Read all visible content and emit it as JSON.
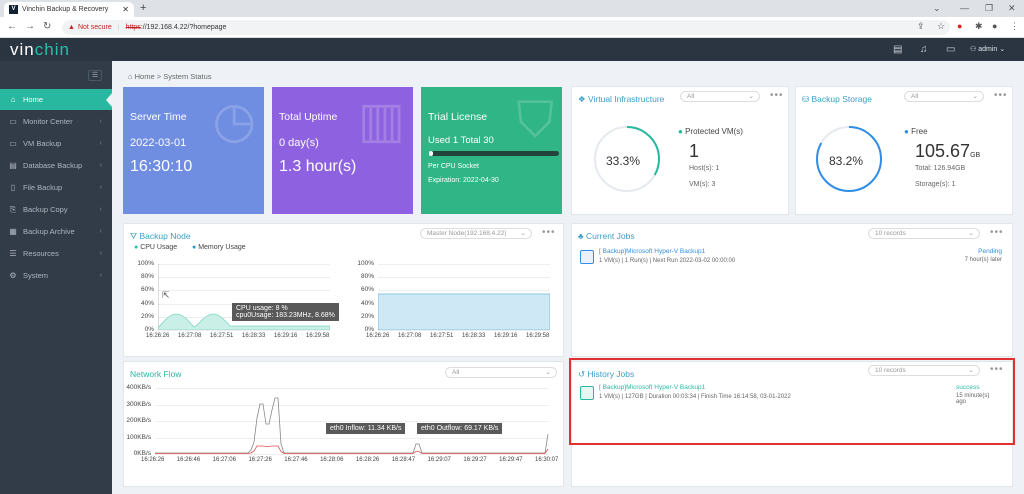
{
  "browser": {
    "tab_title": "Vinchin Backup & Recovery",
    "not_secure": "Not secure",
    "url_scheme": "https",
    "url_rest": "://192.168.4.22/?homepage"
  },
  "header": {
    "logo_a": "vin",
    "logo_b": "chin",
    "user": "admin"
  },
  "sidebar": {
    "items": [
      {
        "label": "Home",
        "icon": "home-icon"
      },
      {
        "label": "Monitor Center",
        "icon": "monitor-icon"
      },
      {
        "label": "VM Backup",
        "icon": "vm-icon"
      },
      {
        "label": "Database Backup",
        "icon": "database-icon"
      },
      {
        "label": "File Backup",
        "icon": "file-icon"
      },
      {
        "label": "Backup Copy",
        "icon": "copy-icon"
      },
      {
        "label": "Backup Archive",
        "icon": "archive-icon"
      },
      {
        "label": "Resources",
        "icon": "resources-icon"
      },
      {
        "label": "System",
        "icon": "system-icon"
      }
    ]
  },
  "breadcrumb": {
    "home": "Home",
    "current": "System Status"
  },
  "cards": {
    "server_time": {
      "title": "Server Time",
      "date": "2022-03-01",
      "time": "16:30:10",
      "color": "#6f8de1"
    },
    "uptime": {
      "title": "Total Uptime",
      "days": "0 day(s)",
      "hours": "1.3 hour(s)",
      "color": "#8e61e0"
    },
    "license": {
      "title": "Trial License",
      "used": "Used 1  Total 30",
      "used_fraction": 0.033,
      "per": "Per CPU Socket",
      "expiration": "Expiration: 2022-04-30",
      "color": "#2fb586"
    }
  },
  "virtual_infra": {
    "title": "Virtual Infrastructure",
    "filter": "All",
    "percent": "33.3%",
    "percent_value": 33.3,
    "label": "Protected VM(s)",
    "count": "1",
    "hosts": "Host(s): 1",
    "vms": "VM(s): 3"
  },
  "backup_storage": {
    "title": "Backup Storage",
    "filter": "All",
    "percent": "83.2%",
    "percent_value": 83.2,
    "label": "Free",
    "free": "105.67",
    "unit": "GB",
    "total": "Total: 126.94GB",
    "storages": "Storage(s): 1"
  },
  "backup_node": {
    "title": "Backup Node",
    "node": "Master Node(192.168.4.22)",
    "legend_cpu": "CPU Usage",
    "legend_mem": "Memory Usage",
    "yticks": [
      "100%",
      "80%",
      "60%",
      "40%",
      "20%",
      "0%"
    ],
    "xticks": [
      "16:26:26",
      "16:27:08",
      "16:27:51",
      "16:28:33",
      "16:29:16",
      "16:29:58"
    ],
    "tooltip_l1": "CPU usage: 8 %",
    "tooltip_l2": "cpu0Usage: 183.23MHz, 8.68%"
  },
  "network_flow": {
    "title": "Network Flow",
    "filter": "All",
    "yticks": [
      "400KB/s",
      "300KB/s",
      "200KB/s",
      "100KB/s",
      "0KB/s"
    ],
    "xticks": [
      "16:26:26",
      "16:26:46",
      "16:27:06",
      "16:27:26",
      "16:27:46",
      "16:28:06",
      "16:28:26",
      "16:28:47",
      "16:29:07",
      "16:29:27",
      "16:29:47",
      "16:30:07"
    ],
    "inflow": "eth0 Inflow: 11.34 KB/s",
    "outflow": "eth0 Outflow: 69.17 KB/s"
  },
  "current_jobs": {
    "title": "Current Jobs",
    "records": "10 records",
    "job": {
      "name": "[ Backup]Microsoft Hyper-V Backup1",
      "details": "1 VM(s) | 1 Run(s) | Next Run 2022-03-02 00:00:00",
      "status": "Pending",
      "time": "7 hour(s) later"
    }
  },
  "history_jobs": {
    "title": "History Jobs",
    "records": "10 records",
    "job": {
      "name": "[ Backup]Microsoft Hyper-V Backup1",
      "details": "1 VM(s) | 127GB | Duration 00:03:34 | Finish Time 16:14:58, 03-01-2022",
      "status": "success",
      "time": "15 minute(s) ago"
    }
  },
  "colors": {
    "accent": "#28b8a0",
    "highlight": "#e03030",
    "link": "#2f8fe6"
  }
}
